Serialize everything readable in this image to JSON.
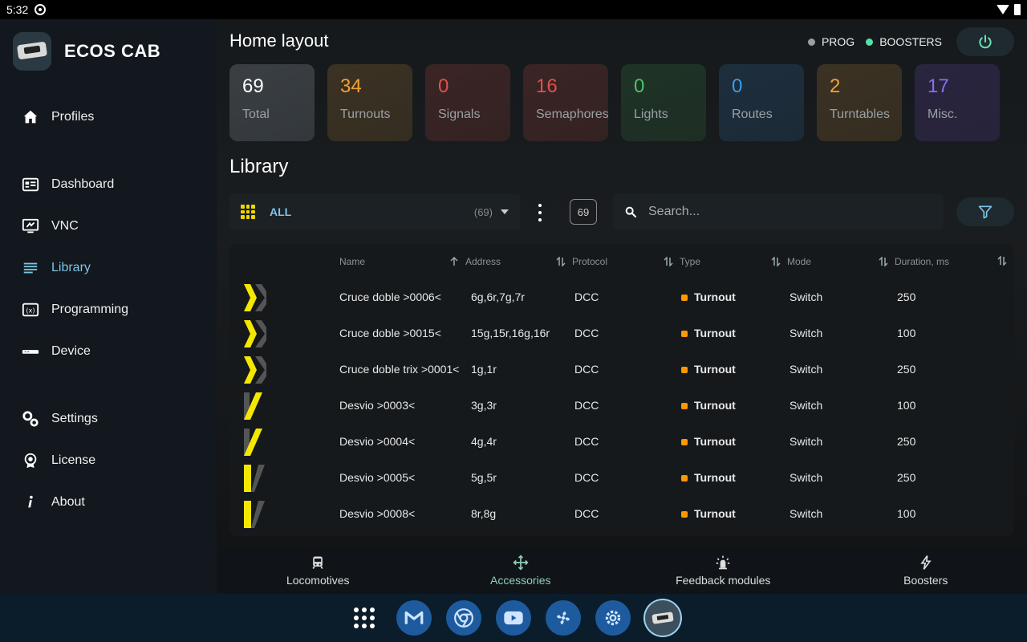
{
  "status_bar": {
    "time": "5:32"
  },
  "sidebar": {
    "brand": "ECOS CAB",
    "items": [
      {
        "label": "Profiles",
        "icon": "home-icon",
        "active": false
      },
      {
        "label": "Dashboard",
        "icon": "dashboard-icon",
        "active": false
      },
      {
        "label": "VNC",
        "icon": "vnc-icon",
        "active": false
      },
      {
        "label": "Library",
        "icon": "library-icon",
        "active": true
      },
      {
        "label": "Programming",
        "icon": "programming-icon",
        "active": false
      },
      {
        "label": "Device",
        "icon": "device-icon",
        "active": false
      },
      {
        "label": "Settings",
        "icon": "settings-icon",
        "active": false
      },
      {
        "label": "License",
        "icon": "license-icon",
        "active": false
      },
      {
        "label": "About",
        "icon": "about-icon",
        "active": false
      }
    ]
  },
  "header": {
    "title": "Home layout",
    "prog_label": "PROG",
    "prog_color": "#9e9e9e",
    "boosters_label": "BOOSTERS",
    "boosters_color": "#4ee6a8"
  },
  "stats": [
    {
      "value": "69",
      "label": "Total",
      "color": "#ffffff",
      "bg": "#3a3f44"
    },
    {
      "value": "34",
      "label": "Turnouts",
      "color": "#f2a23a",
      "bg": "#3b3222"
    },
    {
      "value": "0",
      "label": "Signals",
      "color": "#e0524a",
      "bg": "#3b2424"
    },
    {
      "value": "16",
      "label": "Semaphores",
      "color": "#e0524a",
      "bg": "#3b2424"
    },
    {
      "value": "0",
      "label": "Lights",
      "color": "#4cc36a",
      "bg": "#1f3326"
    },
    {
      "value": "0",
      "label": "Routes",
      "color": "#3a9ee8",
      "bg": "#1d2e3d"
    },
    {
      "value": "2",
      "label": "Turntables",
      "color": "#f2a23a",
      "bg": "#3b3222"
    },
    {
      "value": "17",
      "label": "Misc.",
      "color": "#8a6ef0",
      "bg": "#2a2540"
    }
  ],
  "library": {
    "title": "Library",
    "filter_label": "ALL",
    "filter_count": "(69)",
    "total_count": "69",
    "search_placeholder": "Search...",
    "columns": [
      "Name",
      "Address",
      "Protocol",
      "Type",
      "Mode",
      "Duration, ms"
    ],
    "rows": [
      {
        "icon": "crossing-icon",
        "name": "Cruce doble >0006<",
        "address": "6g,6r,7g,7r",
        "protocol": "DCC",
        "type": "Turnout",
        "mode": "Switch",
        "duration": "250"
      },
      {
        "icon": "crossing-icon",
        "name": "Cruce doble >0015<",
        "address": "15g,15r,16g,16r",
        "protocol": "DCC",
        "type": "Turnout",
        "mode": "Switch",
        "duration": "100"
      },
      {
        "icon": "crossing-icon",
        "name": "Cruce doble trix >0001<",
        "address": "1g,1r",
        "protocol": "DCC",
        "type": "Turnout",
        "mode": "Switch",
        "duration": "250"
      },
      {
        "icon": "diverging-turnout-icon",
        "name": "Desvio >0003<",
        "address": "3g,3r",
        "protocol": "DCC",
        "type": "Turnout",
        "mode": "Switch",
        "duration": "100"
      },
      {
        "icon": "diverging-turnout-icon",
        "name": "Desvio >0004<",
        "address": "4g,4r",
        "protocol": "DCC",
        "type": "Turnout",
        "mode": "Switch",
        "duration": "250"
      },
      {
        "icon": "straight-turnout-icon",
        "name": "Desvio >0005<",
        "address": "5g,5r",
        "protocol": "DCC",
        "type": "Turnout",
        "mode": "Switch",
        "duration": "250"
      },
      {
        "icon": "straight-turnout-icon",
        "name": "Desvio >0008<",
        "address": "8r,8g",
        "protocol": "DCC",
        "type": "Turnout",
        "mode": "Switch",
        "duration": "100"
      }
    ],
    "type_color": "#ff9800"
  },
  "bottom_tabs": [
    {
      "label": "Locomotives",
      "icon": "train-icon",
      "active": false
    },
    {
      "label": "Accessories",
      "icon": "accessories-icon",
      "active": true
    },
    {
      "label": "Feedback modules",
      "icon": "feedback-icon",
      "active": false
    },
    {
      "label": "Boosters",
      "icon": "booster-icon",
      "active": false
    }
  ],
  "dock": [
    "app-drawer-icon",
    "gmail-icon",
    "chrome-icon",
    "youtube-icon",
    "fan-app-icon",
    "settings-app-icon",
    "ecos-cab-app-icon"
  ]
}
